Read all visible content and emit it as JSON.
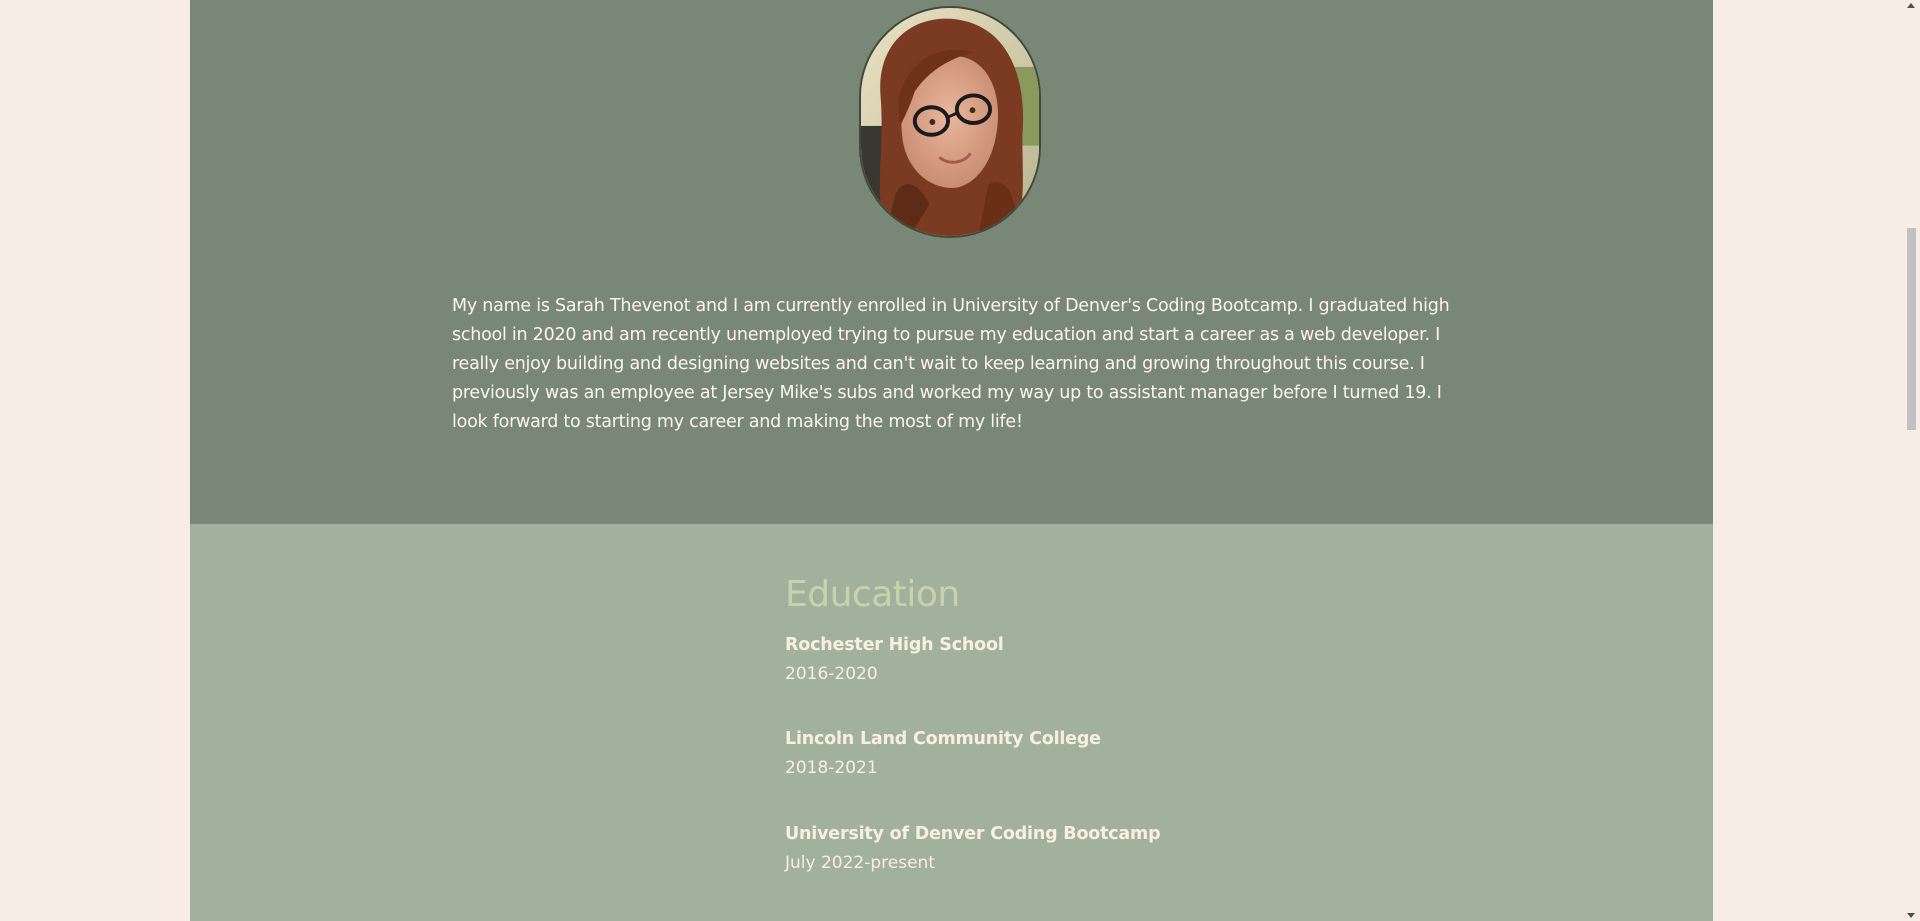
{
  "about": {
    "photo_alt": "Profile photo",
    "bio": "My name is Sarah Thevenot and I am currently enrolled in University of Denver's Coding Bootcamp. I graduated high school in 2020 and am recently unemployed trying to pursue my education and start a career as a web developer. I really enjoy building and designing websites and can't wait to keep learning and growing throughout this course. I previously was an employee at Jersey Mike's subs and worked my way up to assistant manager before I turned 19. I look forward to starting my career and making the most of my life!"
  },
  "education": {
    "heading": "Education",
    "items": [
      {
        "school": "Rochester High School",
        "years": "2016-2020"
      },
      {
        "school": "Lincoln Land Community College",
        "years": "2018-2021"
      },
      {
        "school": "University of Denver Coding Bootcamp",
        "years": "July 2022-present"
      }
    ]
  },
  "colors": {
    "page_background": "#f7ede4",
    "about_background": "#788776",
    "education_background": "#a2b19e",
    "heading_color": "#c7d4ab",
    "text_color": "#fbf5ec"
  }
}
